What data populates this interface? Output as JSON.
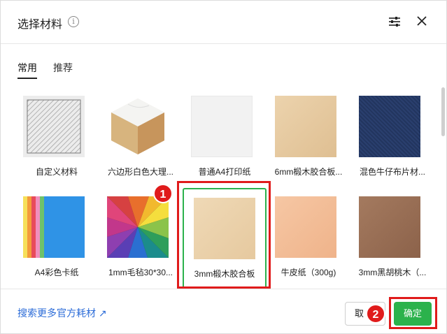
{
  "dialog": {
    "title": "选择材料",
    "info_icon": "info-icon",
    "info_glyph": "i",
    "settings_icon": "sliders-icon",
    "close_icon": "close-icon"
  },
  "tabs": [
    {
      "label": "常用",
      "active": true
    },
    {
      "label": "推荐",
      "active": false
    }
  ],
  "materials": [
    {
      "label": "自定义材料",
      "swatch": "custom"
    },
    {
      "label": "六边形白色大理...",
      "swatch": "marble-hexagon"
    },
    {
      "label": "普通A4打印纸",
      "swatch": "#f2f2f2"
    },
    {
      "label": "6mm椴木胶合板...",
      "swatch": "#e6c9a1"
    },
    {
      "label": "混色牛仔布片材...",
      "swatch": "#2a3f6e"
    },
    {
      "label": "A4彩色卡纸",
      "swatch": "multicolor-cards"
    },
    {
      "label": "1mm毛毡30*30...",
      "swatch": "color-wheel"
    },
    {
      "label": "3mm椴木胶合板",
      "swatch": "#ebd2ad",
      "selected": true
    },
    {
      "label": "牛皮纸（300g)",
      "swatch": "#f3bd98"
    },
    {
      "label": "3mm黑胡桃木（...",
      "swatch": "#9a6f55"
    }
  ],
  "annotations": [
    {
      "number": "1"
    },
    {
      "number": "2"
    }
  ],
  "footer": {
    "search_link": "搜索更多官方耗材 ↗",
    "cancel_label": "取",
    "confirm_label": "确定"
  },
  "colors": {
    "accent_green": "#2bb24c",
    "link_blue": "#2c6cd8",
    "annotation_red": "#e01b1b"
  }
}
